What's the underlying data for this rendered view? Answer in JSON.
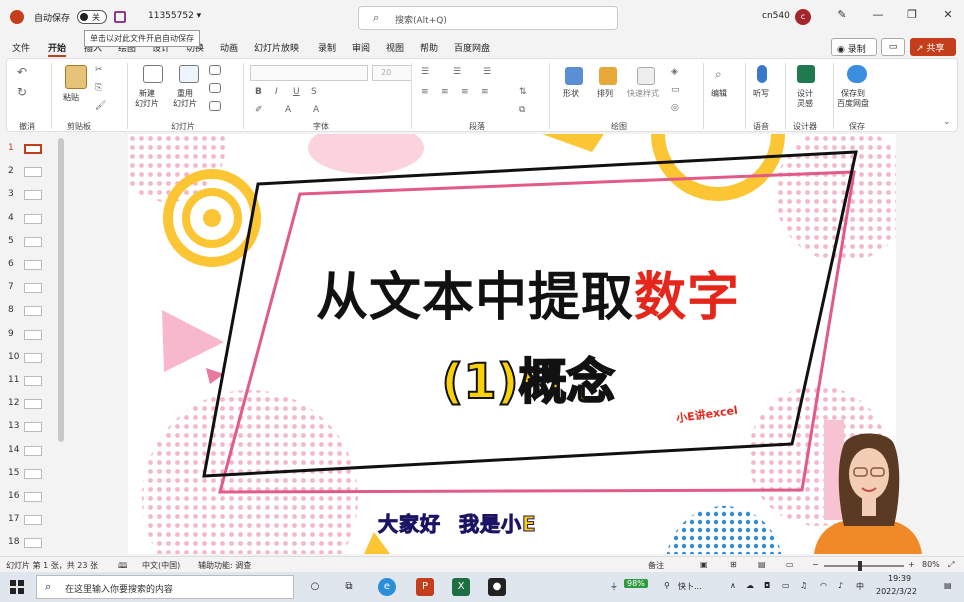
{
  "titlebar": {
    "autosave_label": "自动保存",
    "autosave_state": "关",
    "filename": "11355752 ▾",
    "search_placeholder": "搜索(Alt+Q)",
    "user": "cn540",
    "avatar_letter": "c",
    "tooltip": "单击以对此文件开启自动保存"
  },
  "tabs": [
    "文件",
    "开始",
    "插入",
    "绘图",
    "设计",
    "切换",
    "动画",
    "幻灯片放映",
    "录制",
    "审阅",
    "视图",
    "帮助",
    "百度网盘"
  ],
  "tab_active_index": 1,
  "actions": {
    "record": "录制",
    "share": "共享"
  },
  "ribbon": {
    "groups": [
      "撤消",
      "剪贴板",
      "幻灯片",
      "字体",
      "段落",
      "绘图",
      "语音",
      "设计器",
      "保存"
    ],
    "buttons": {
      "paste": "粘贴",
      "new_slide": "新建\n幻灯片",
      "reuse_slide": "重用\n幻灯片",
      "shapes": "形状",
      "arrange": "排列",
      "quick_styles": "快速样式",
      "editing": "编辑",
      "dictate": "听写",
      "designer": "设计\n灵感",
      "save_baidu": "保存到\n百度网盘"
    },
    "font_size": "20"
  },
  "thumbnails": [
    "1",
    "2",
    "3",
    "4",
    "5",
    "6",
    "7",
    "8",
    "9",
    "10",
    "11",
    "12",
    "13",
    "14",
    "15",
    "16",
    "17",
    "18"
  ],
  "thumbnail_selected": 0,
  "slide": {
    "title_black": "从文本中提取",
    "title_red": "数字",
    "subtitle": "(1)概念",
    "watermark": "小E讲excel",
    "caption": "大家好 我是小E"
  },
  "status": {
    "slide_info": "幻灯片 第 1 张，共 23 张",
    "language": "中文(中国)",
    "accessibility": "辅助功能: 调查",
    "notes": "备注",
    "zoom": "80%"
  },
  "taskbar": {
    "search_placeholder": "在这里输入你要搜索的内容",
    "battery": "98%",
    "tray_label": "快卜...",
    "time": "19:39",
    "date": "2022/3/22"
  },
  "colors": {
    "accent": "#c43e1c",
    "title_red": "#e5261a",
    "subtitle_yellow": "#f8d10a",
    "frame_pink": "#e25a8a"
  }
}
